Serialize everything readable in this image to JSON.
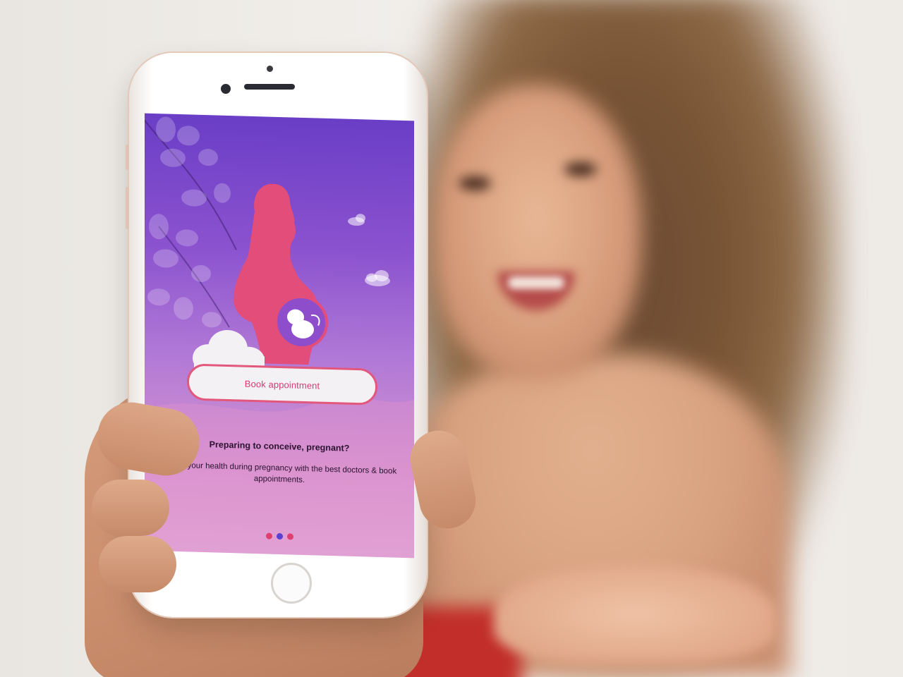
{
  "onboarding": {
    "button_label": "Book appointment",
    "title": "Preparing to conceive, pregnant?",
    "description": "Check your health during pregnancy with the best doctors & book appointments.",
    "page_indicator": {
      "total": 3,
      "active_index": 1
    }
  },
  "colors": {
    "accent_pink": "#e2577c",
    "button_text": "#d63a72",
    "dot_inactive": "#e0406f",
    "dot_active": "#5a3fd0",
    "silhouette": "#e34d7a"
  },
  "icons": [
    "mother-silhouette-illustration",
    "fetus-icon",
    "cloud-icon",
    "leaf-branch-illustration"
  ]
}
